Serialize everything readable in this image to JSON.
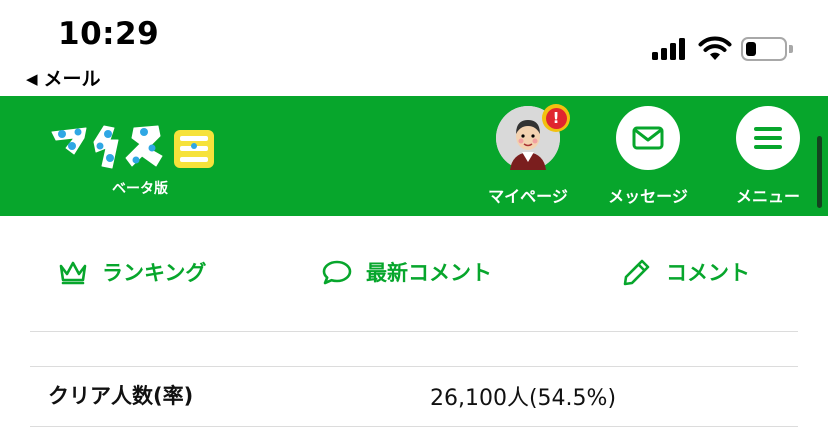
{
  "status_bar": {
    "time": "10:29",
    "back_label": "メール"
  },
  "header": {
    "logo_sub": "ベータ版",
    "brand_color": "#07a62c",
    "nav": [
      {
        "label": "マイページ",
        "icon": "avatar",
        "alert": "!"
      },
      {
        "label": "メッセージ",
        "icon": "envelope-icon"
      },
      {
        "label": "メニュー",
        "icon": "hamburger-icon"
      }
    ]
  },
  "tabs": [
    {
      "label": "ランキング",
      "icon": "crown-icon"
    },
    {
      "label": "最新コメント",
      "icon": "speech-bubble-icon"
    },
    {
      "label": "コメント",
      "icon": "pencil-icon"
    }
  ],
  "stats": {
    "clear_label": "クリア人数(率)",
    "clear_value": "26,100人(54.5%)"
  }
}
